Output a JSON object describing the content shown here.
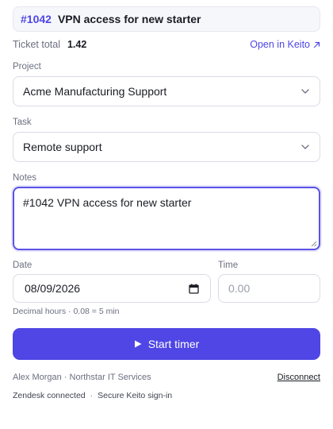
{
  "ticket": {
    "id": "#1042",
    "subject": "VPN access for new starter"
  },
  "summary": {
    "total_label": "Ticket total",
    "total_value": "1.42",
    "open_link": "Open in Keito"
  },
  "project": {
    "label": "Project",
    "value": "Acme Manufacturing Support"
  },
  "task": {
    "label": "Task",
    "value": "Remote support"
  },
  "notes": {
    "label": "Notes",
    "value": "#1042 VPN access for new starter"
  },
  "date": {
    "label": "Date",
    "value": "08/09/2026"
  },
  "time": {
    "label": "Time",
    "placeholder": "0.00"
  },
  "hint": "Decimal hours · 0.08 = 5 min",
  "start_button": "Start timer",
  "footer": {
    "account": "Alex Morgan · Northstar IT Services",
    "disconnect": "Disconnect",
    "status_zendesk": "Zendesk connected",
    "separator": "·",
    "status_signin": "Secure Keito sign-in"
  },
  "colors": {
    "accent": "#4f46e5",
    "focus_border": "#5b52e6"
  }
}
